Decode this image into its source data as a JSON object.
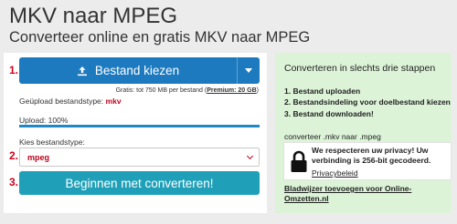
{
  "header": {
    "title": "MKV naar MPEG",
    "subtitle": "Converteer online en gratis MKV naar MPEG"
  },
  "left": {
    "step_numbers": [
      "1.",
      "2.",
      "3."
    ],
    "upload_button_label": "Bestand kiezen",
    "limit_text": "Gratis: tot 750 MB per bestand (",
    "limit_premium": "Premium: 20 GB",
    "limit_close": ")",
    "uploaded_type_label": "Geüpload bestandstype:",
    "uploaded_type_value": "mkv",
    "upload_progress_label": "Upload: 100%",
    "upload_progress": 1.0,
    "choose_type_label": "Kies bestandstype:",
    "selected_format": "mpeg",
    "convert_button_label": "Beginnen met converteren!"
  },
  "right": {
    "title": "Converteren in slechts drie stappen",
    "steps": [
      "Bestand uploaden",
      "Bestandsindeling voor doelbestand kiezen",
      "Bestand downloaden!"
    ],
    "step_prefixes": [
      "1.",
      "2.",
      "3."
    ],
    "convert_note": "converteer .mkv naar .mpeg",
    "privacy_text": "We respecteren uw privacy! Uw verbinding is 256-bit gecodeerd.",
    "privacy_link": "Privacybeleid",
    "bookmark_link": "Bladwijzer toevoegen voor Online-Omzetten.nl"
  },
  "colors": {
    "upload_button": "#1e7abf",
    "convert_button": "#1fa0b8",
    "accent_red": "#c0001a",
    "right_panel": "#dcf3d8"
  },
  "icons": {
    "upload": "upload-icon",
    "dropdown": "chevron-down-icon",
    "lock": "lock-icon"
  }
}
